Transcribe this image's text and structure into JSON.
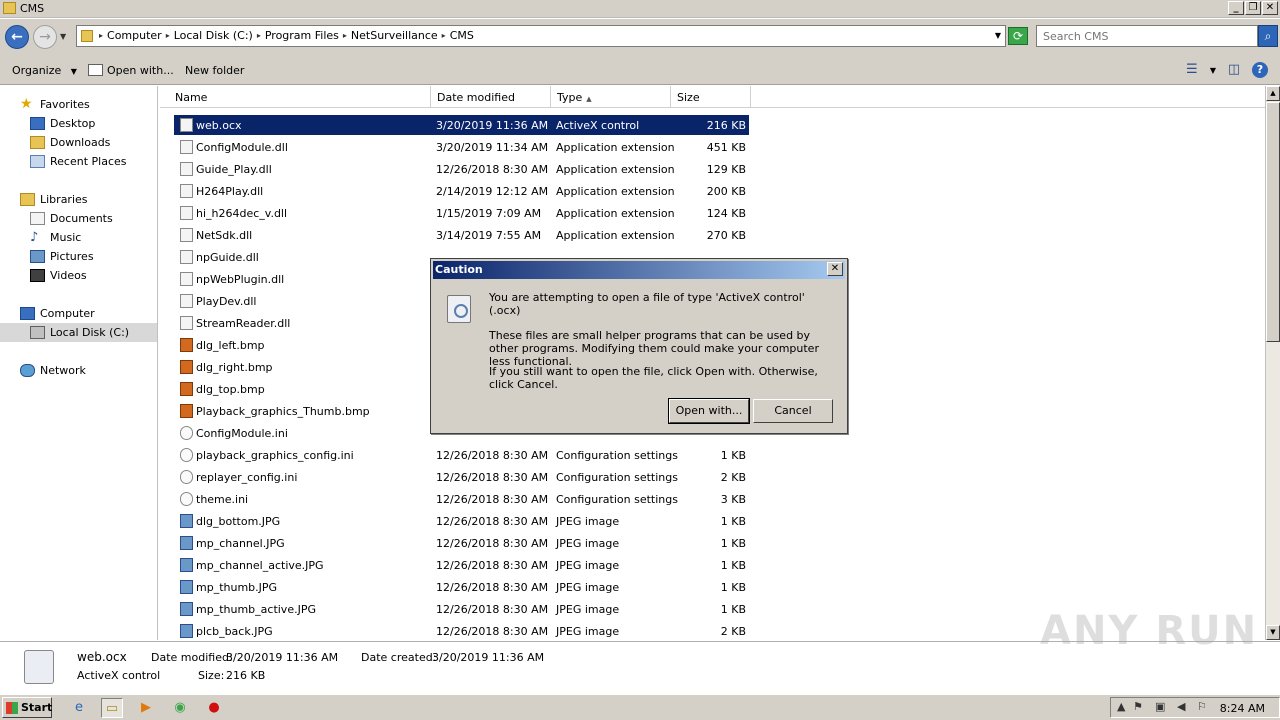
{
  "window": {
    "title": "CMS"
  },
  "address": {
    "crumbs": [
      "Computer",
      "Local Disk (C:)",
      "Program Files",
      "NetSurveillance",
      "CMS"
    ],
    "search_placeholder": "Search CMS"
  },
  "toolbar": {
    "organize": "Organize",
    "open_with": "Open with...",
    "new_folder": "New folder"
  },
  "nav": {
    "favorites": "Favorites",
    "desktop": "Desktop",
    "downloads": "Downloads",
    "recent": "Recent Places",
    "libraries": "Libraries",
    "documents": "Documents",
    "music": "Music",
    "pictures": "Pictures",
    "videos": "Videos",
    "computer": "Computer",
    "localdisk": "Local Disk (C:)",
    "network": "Network"
  },
  "columns": {
    "name": "Name",
    "date": "Date modified",
    "type": "Type",
    "size": "Size"
  },
  "files": [
    {
      "name": "web.ocx",
      "date": "3/20/2019 11:36 AM",
      "type": "ActiveX control",
      "size": "216 KB",
      "icon": "dll"
    },
    {
      "name": "ConfigModule.dll",
      "date": "3/20/2019 11:34 AM",
      "type": "Application extension",
      "size": "451 KB",
      "icon": "dll"
    },
    {
      "name": "Guide_Play.dll",
      "date": "12/26/2018 8:30 AM",
      "type": "Application extension",
      "size": "129 KB",
      "icon": "dll"
    },
    {
      "name": "H264Play.dll",
      "date": "2/14/2019 12:12 AM",
      "type": "Application extension",
      "size": "200 KB",
      "icon": "dll"
    },
    {
      "name": "hi_h264dec_v.dll",
      "date": "1/15/2019 7:09 AM",
      "type": "Application extension",
      "size": "124 KB",
      "icon": "dll"
    },
    {
      "name": "NetSdk.dll",
      "date": "3/14/2019 7:55 AM",
      "type": "Application extension",
      "size": "270 KB",
      "icon": "dll"
    },
    {
      "name": "npGuide.dll",
      "date": "",
      "type": "",
      "size": "",
      "icon": "dll"
    },
    {
      "name": "npWebPlugin.dll",
      "date": "",
      "type": "",
      "size": "",
      "icon": "dll"
    },
    {
      "name": "PlayDev.dll",
      "date": "",
      "type": "",
      "size": "",
      "icon": "dll"
    },
    {
      "name": "StreamReader.dll",
      "date": "",
      "type": "",
      "size": "",
      "icon": "dll"
    },
    {
      "name": "dlg_left.bmp",
      "date": "",
      "type": "",
      "size": "",
      "icon": "bmp"
    },
    {
      "name": "dlg_right.bmp",
      "date": "",
      "type": "",
      "size": "",
      "icon": "bmp"
    },
    {
      "name": "dlg_top.bmp",
      "date": "",
      "type": "",
      "size": "",
      "icon": "bmp"
    },
    {
      "name": "Playback_graphics_Thumb.bmp",
      "date": "",
      "type": "",
      "size": "",
      "icon": "bmp"
    },
    {
      "name": "ConfigModule.ini",
      "date": "",
      "type": "",
      "size": "",
      "icon": "ini"
    },
    {
      "name": "playback_graphics_config.ini",
      "date": "12/26/2018 8:30 AM",
      "type": "Configuration settings",
      "size": "1 KB",
      "icon": "ini"
    },
    {
      "name": "replayer_config.ini",
      "date": "12/26/2018 8:30 AM",
      "type": "Configuration settings",
      "size": "2 KB",
      "icon": "ini"
    },
    {
      "name": "theme.ini",
      "date": "12/26/2018 8:30 AM",
      "type": "Configuration settings",
      "size": "3 KB",
      "icon": "ini"
    },
    {
      "name": "dlg_bottom.JPG",
      "date": "12/26/2018 8:30 AM",
      "type": "JPEG image",
      "size": "1 KB",
      "icon": "jpg"
    },
    {
      "name": "mp_channel.JPG",
      "date": "12/26/2018 8:30 AM",
      "type": "JPEG image",
      "size": "1 KB",
      "icon": "jpg"
    },
    {
      "name": "mp_channel_active.JPG",
      "date": "12/26/2018 8:30 AM",
      "type": "JPEG image",
      "size": "1 KB",
      "icon": "jpg"
    },
    {
      "name": "mp_thumb.JPG",
      "date": "12/26/2018 8:30 AM",
      "type": "JPEG image",
      "size": "1 KB",
      "icon": "jpg"
    },
    {
      "name": "mp_thumb_active.JPG",
      "date": "12/26/2018 8:30 AM",
      "type": "JPEG image",
      "size": "1 KB",
      "icon": "jpg"
    },
    {
      "name": "plcb_back.JPG",
      "date": "12/26/2018 8:30 AM",
      "type": "JPEG image",
      "size": "2 KB",
      "icon": "jpg"
    }
  ],
  "details": {
    "name": "web.ocx",
    "type": "ActiveX control",
    "date_modified_label": "Date modified:",
    "date_modified": "3/20/2019 11:36 AM",
    "date_created_label": "Date created:",
    "date_created": "3/20/2019 11:36 AM",
    "size_label": "Size:",
    "size": "216 KB"
  },
  "dialog": {
    "title": "Caution",
    "line1": "You are attempting to open a file of type 'ActiveX control' (.ocx)",
    "line2": "These files are small helper programs that can be used by other programs. Modifying them could make your computer less functional.",
    "line3": "If you still want to open the file, click Open with. Otherwise, click Cancel.",
    "ok": "Open with...",
    "cancel": "Cancel"
  },
  "taskbar": {
    "start": "Start",
    "clock": "8:24 AM"
  },
  "watermark": "ANY RUN",
  "colors": {
    "selection": "#0a246a",
    "chrome": "#d4d0c8"
  }
}
